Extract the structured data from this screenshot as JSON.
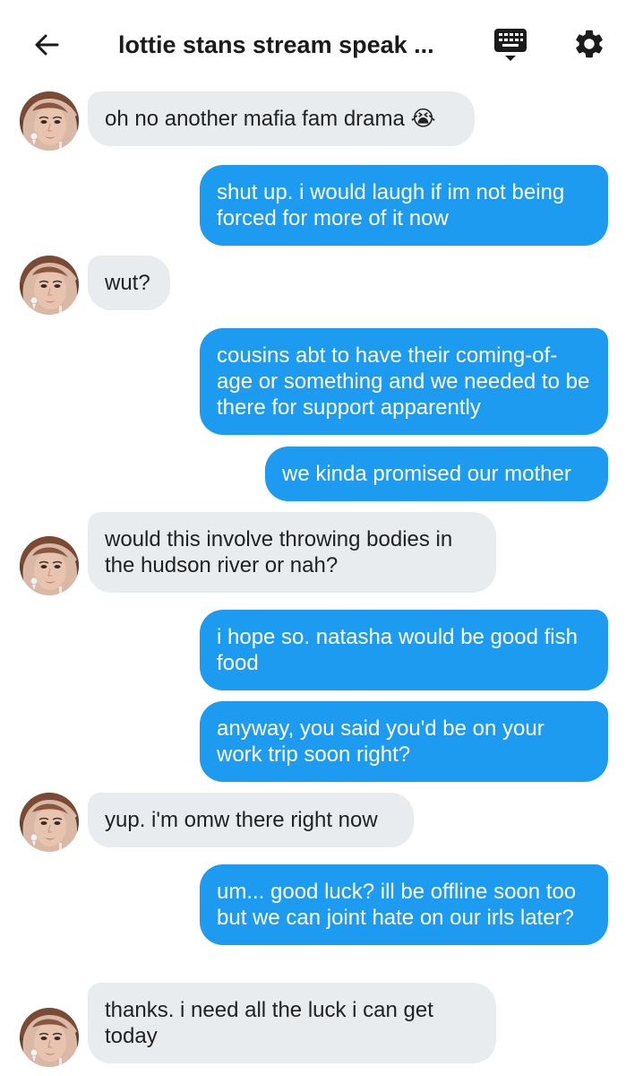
{
  "header": {
    "title": "lottie stans stream speak ...",
    "back_icon": "arrow-left-icon",
    "keyboard_icon": "keyboard-icon",
    "settings_icon": "gear-icon"
  },
  "colors": {
    "sent_bubble": "#1d9bf0",
    "received_bubble": "#e9ecef",
    "header_text": "#1b1b1b"
  },
  "messages": [
    {
      "side": "received",
      "text": "oh no another mafia fam drama 😭"
    },
    {
      "side": "sent",
      "text": "shut up. i would laugh if im not being forced for more of it now"
    },
    {
      "side": "received",
      "text": "wut?"
    },
    {
      "side": "sent",
      "text": "cousins abt to have their coming-of-age or something and we needed to be there for support apparently"
    },
    {
      "side": "sent",
      "text": "we kinda promised our mother"
    },
    {
      "side": "received",
      "text": "would this involve throwing bodies in the hudson river or nah?"
    },
    {
      "side": "sent",
      "text": "i hope so. natasha would be good fish food"
    },
    {
      "side": "sent",
      "text": "anyway, you said you'd be on your work trip soon right?"
    },
    {
      "side": "received",
      "text": "yup. i'm omw there right now"
    },
    {
      "side": "sent",
      "text": "um... good luck? ill be offline soon too but we can joint hate on our irls later?"
    },
    {
      "side": "received",
      "text": "thanks. i need all the luck i can get today"
    }
  ]
}
